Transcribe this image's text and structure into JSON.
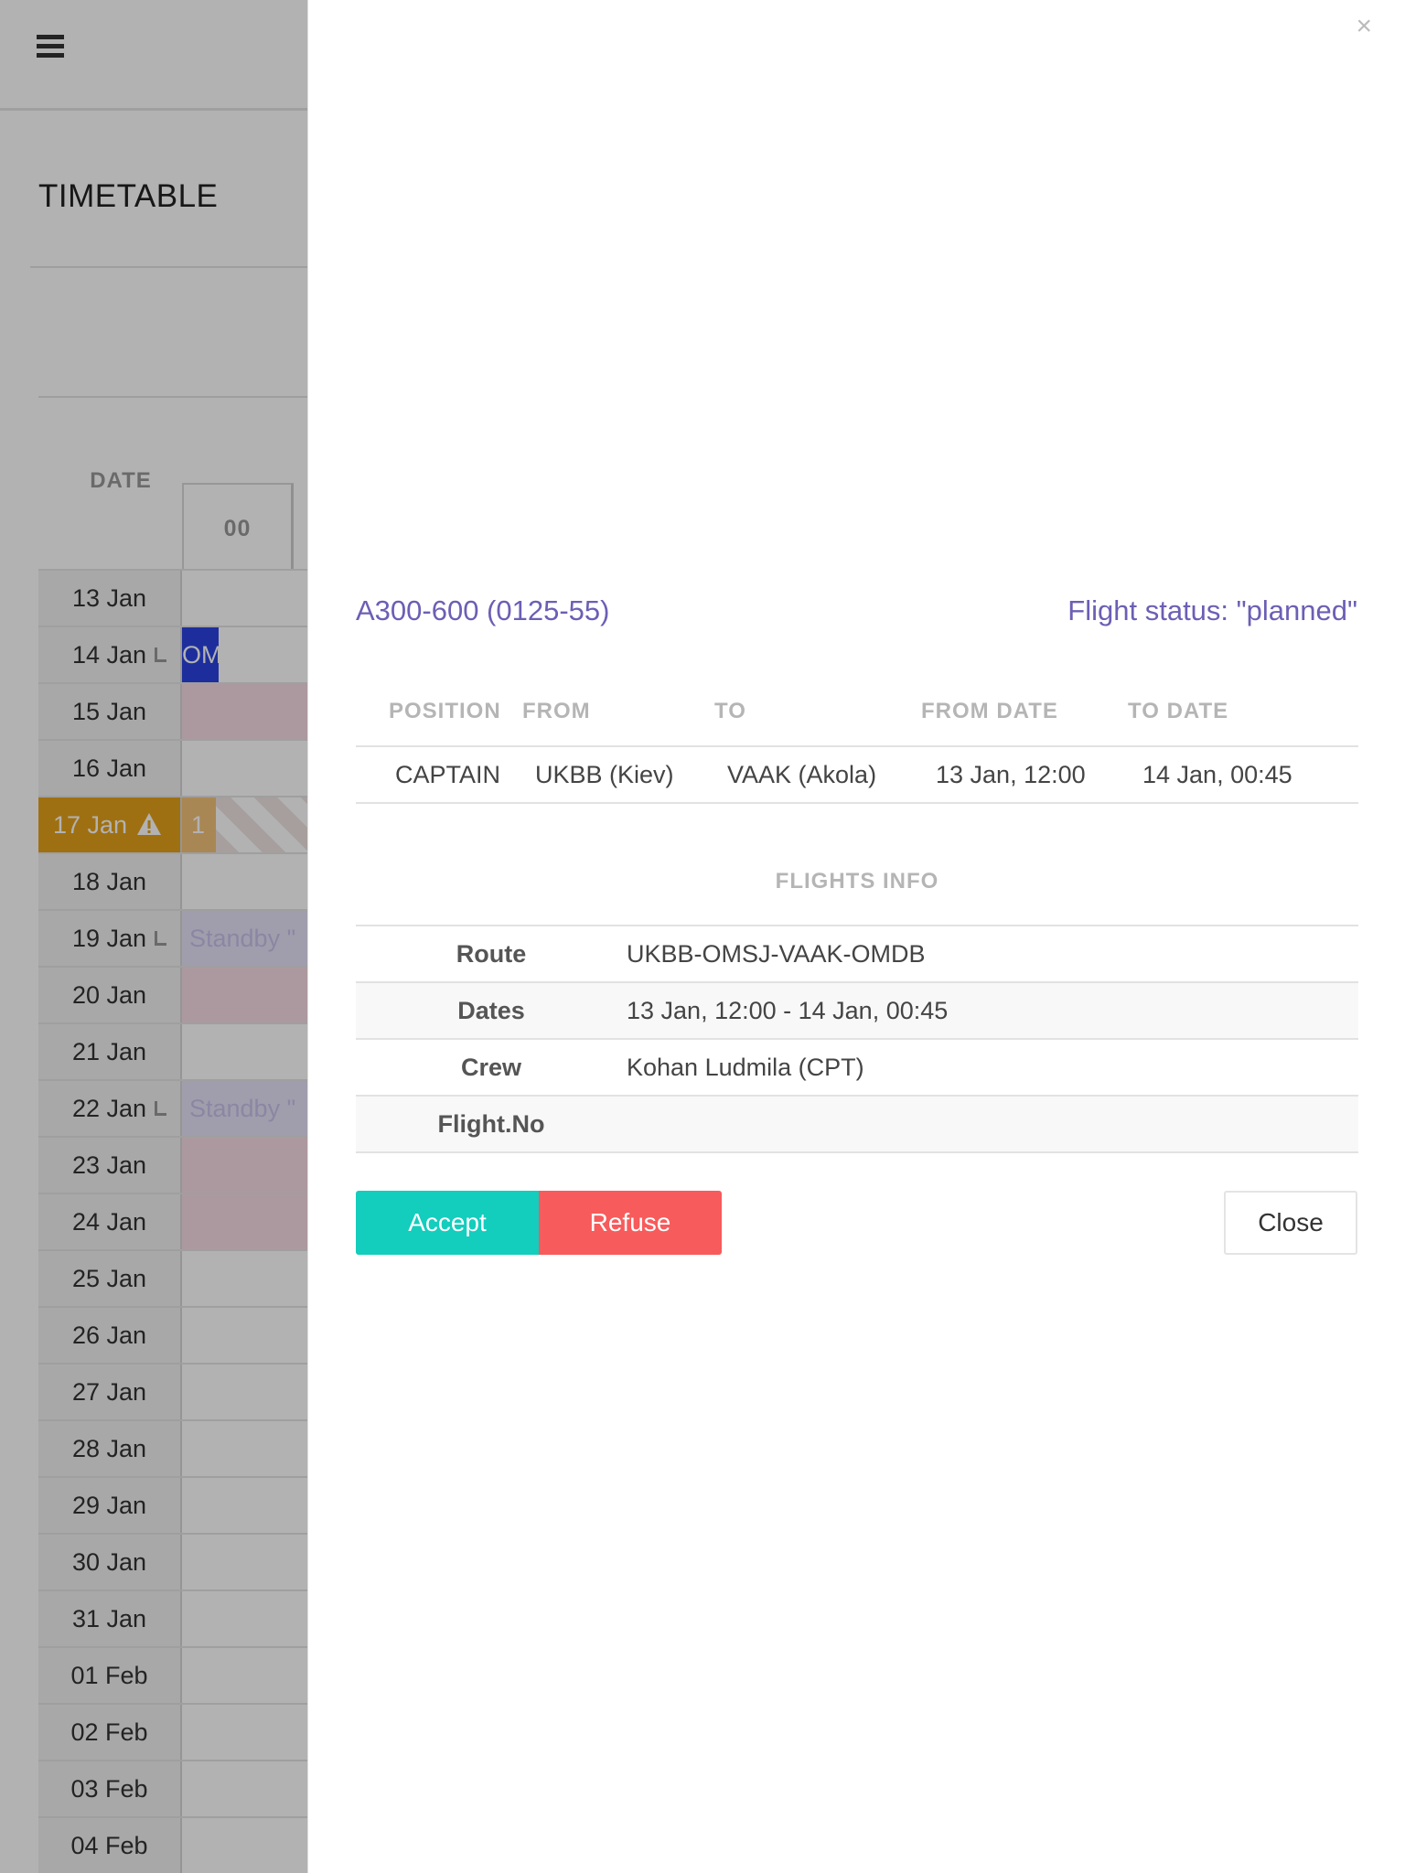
{
  "app": {
    "title": "TIMETABLE",
    "date_header": "DATE",
    "hour_header": "00",
    "rows": [
      {
        "date": "13 Jan",
        "cell": ""
      },
      {
        "date": "14 Jan",
        "cell": "blue",
        "event": "OM"
      },
      {
        "date": "15 Jan",
        "cell": "pink"
      },
      {
        "date": "16 Jan",
        "cell": ""
      },
      {
        "date": "17 Jan",
        "cell": "orange",
        "event": "1",
        "warning": true
      },
      {
        "date": "18 Jan",
        "cell": ""
      },
      {
        "date": "19 Jan",
        "cell": "standby",
        "event": "Standby \""
      },
      {
        "date": "20 Jan",
        "cell": "pink"
      },
      {
        "date": "21 Jan",
        "cell": ""
      },
      {
        "date": "22 Jan",
        "cell": "standby",
        "event": "Standby \""
      },
      {
        "date": "23 Jan",
        "cell": "pink"
      },
      {
        "date": "24 Jan",
        "cell": "pink"
      },
      {
        "date": "25 Jan",
        "cell": ""
      },
      {
        "date": "26 Jan",
        "cell": ""
      },
      {
        "date": "27 Jan",
        "cell": ""
      },
      {
        "date": "28 Jan",
        "cell": ""
      },
      {
        "date": "29 Jan",
        "cell": ""
      },
      {
        "date": "30 Jan",
        "cell": ""
      },
      {
        "date": "31 Jan",
        "cell": ""
      },
      {
        "date": "01 Feb",
        "cell": ""
      },
      {
        "date": "02 Feb",
        "cell": ""
      },
      {
        "date": "03 Feb",
        "cell": ""
      },
      {
        "date": "04 Feb",
        "cell": ""
      }
    ]
  },
  "modal": {
    "close_icon": "×",
    "aircraft": "A300-600 (0125-55)",
    "status": "Flight status: \"planned\"",
    "position_table": {
      "headers": [
        "POSITION",
        "FROM",
        "TO",
        "FROM DATE",
        "TO DATE"
      ],
      "row": [
        "CAPTAIN",
        "UKBB (Kiev)",
        "VAAK (Akola)",
        "13 Jan, 12:00",
        "14 Jan, 00:45"
      ]
    },
    "flights_info_title": "FLIGHTS INFO",
    "flights_info": [
      {
        "label": "Route",
        "value": "UKBB-OMSJ-VAAK-OMDB"
      },
      {
        "label": "Dates",
        "value": "13 Jan, 12:00 - 14 Jan, 00:45"
      },
      {
        "label": "Crew",
        "value": "Kohan Ludmila (CPT)"
      },
      {
        "label": "Flight.No",
        "value": ""
      }
    ],
    "accept_label": "Accept",
    "refuse_label": "Refuse",
    "close_label": "Close"
  },
  "colors": {
    "accent_purple": "#6b5fb5",
    "accept": "#13cdbd",
    "refuse": "#f75b5b",
    "warning": "#e4a11b"
  }
}
